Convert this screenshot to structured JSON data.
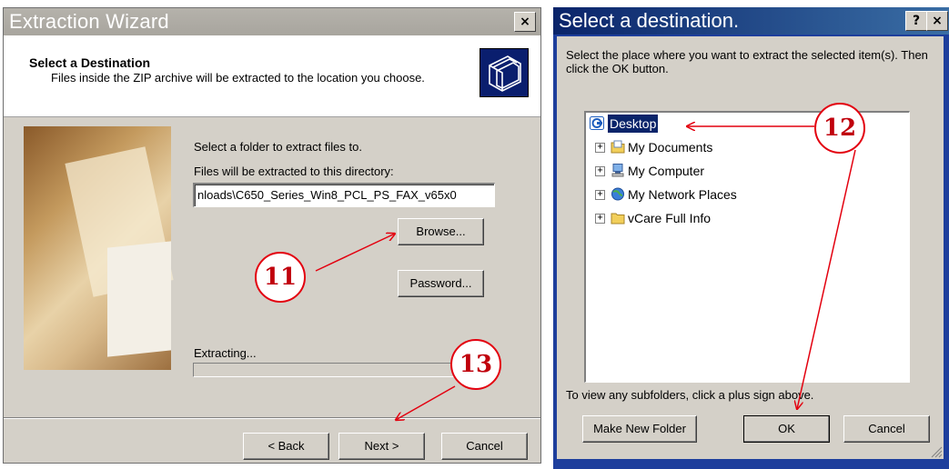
{
  "extraction_wizard": {
    "title": "Extraction Wizard",
    "close_glyph": "×",
    "header_title": "Select a Destination",
    "header_subtitle": "Files inside the ZIP archive will be extracted to the location you choose.",
    "header_icon": "folder-stack-icon",
    "select_folder_label": "Select a folder to extract files to.",
    "directory_label": "Files will be extracted to this directory:",
    "directory_value": "nloads\\C650_Series_Win8_PCL_PS_FAX_v65x0",
    "browse_label": "Browse...",
    "password_label": "Password...",
    "extracting_label": "Extracting...",
    "progress": 0,
    "back_label": "< Back",
    "next_label": "Next >",
    "cancel_label": "Cancel"
  },
  "select_destination": {
    "title": "Select a destination.",
    "help_glyph": "?",
    "close_glyph": "×",
    "instructions": "Select the place where you want to extract the selected item(s).  Then click the OK button.",
    "tree_items": [
      {
        "label": "Desktop",
        "icon": "desktop-icon",
        "selected": true
      },
      {
        "label": "My Documents",
        "icon": "my-documents-icon",
        "expander": "+"
      },
      {
        "label": "My Computer",
        "icon": "my-computer-icon",
        "expander": "+"
      },
      {
        "label": "My Network Places",
        "icon": "network-places-icon",
        "expander": "+"
      },
      {
        "label": "vCare Full Info",
        "icon": "folder-icon",
        "expander": "+"
      }
    ],
    "footer_hint": "To view any subfolders, click a plus sign above.",
    "make_new_folder_label": "Make New Folder",
    "ok_label": "OK",
    "cancel_label": "Cancel"
  },
  "annotations": {
    "step_11": "11",
    "step_12": "12",
    "step_13": "13",
    "color": "#e3000f"
  }
}
